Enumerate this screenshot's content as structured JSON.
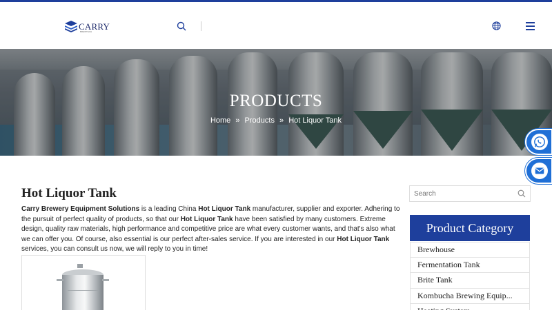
{
  "header": {
    "logo_text": "CARRY",
    "logo_sub": "BREWTECH",
    "icons": {
      "search": "search-icon",
      "language": "globe-icon",
      "menu": "hamburger-menu-icon"
    }
  },
  "banner": {
    "title": "PRODUCTS",
    "breadcrumb": {
      "home": "Home",
      "sep1": "»",
      "products": "Products",
      "sep2": "»",
      "current": "Hot Liquor Tank"
    }
  },
  "contact_buttons": {
    "whatsapp": "whatsapp-icon",
    "email": "email-icon"
  },
  "main": {
    "title": "Hot Liquor Tank",
    "intro": {
      "p1_bold": "Carry Brewery Equipment Solutions",
      "p2": " is a leading China ",
      "p3_bold": "Hot Liquor Tank",
      "p4": " manufacturer, supplier and exporter. Adhering to the pursuit of perfect quality of products, so that our ",
      "p5_bold": "Hot Liquor Tank",
      "p6": " have been satisfied by many customers. Extreme design, quality raw materials, high performance and competitive price are what every customer wants, and that's also what we can offer you. Of course, also essential is our perfect after-sales service. If you are interested in our ",
      "p7_bold": "Hot Liquor Tank",
      "p8": " services, you can consult us now, we will reply to you in time!"
    }
  },
  "sidebar": {
    "search_placeholder": "Search",
    "category_title": "Product Category",
    "categories": [
      "Brewhouse",
      "Fermentation Tank",
      "Brite Tank",
      "Kombucha Brewing Equip...",
      "Heating System"
    ]
  },
  "colors": {
    "brand_blue": "#1e3f9c",
    "contact_blue": "#1f6fd6"
  }
}
